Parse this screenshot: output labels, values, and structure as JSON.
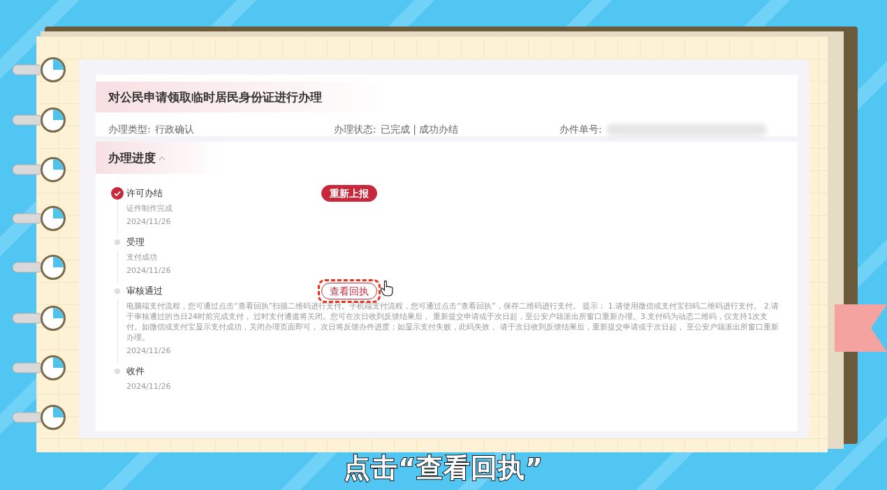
{
  "record": {
    "title": "对公民申请领取临时居民身份证进行办理",
    "fields": [
      {
        "label": "办理类型:",
        "value": "行政确认",
        "blurred": false
      },
      {
        "label": "办理状态:",
        "value": "已完成 | 成功办结",
        "blurred": false
      },
      {
        "label": "办件单号:",
        "blurred": true
      }
    ]
  },
  "progress": {
    "title": "办理进度",
    "expanded": true,
    "steps": [
      {
        "title": "许可办结",
        "done": true,
        "description": "证件制作完成",
        "date": "2024/11/26",
        "button": {
          "label": "重新上报",
          "kind": "filled",
          "highlighted": false
        }
      },
      {
        "title": "受理",
        "done": false,
        "description": "支付成功",
        "date": "2024/11/26"
      },
      {
        "title": "审核通过",
        "done": false,
        "description": "电脑端支付流程，您可通过点击“查看回执”扫描二维码进行支付。手机端支付流程，您可通过点击“查看回执”，保存二维码进行支付。 提示： 1.请使用微信或支付宝扫码二维码进行支付。 2.请于审核通过的当日24时前完成支付， 过时支付通道将关闭。您可在次日收到反馈结果后， 重新提交申请或于次日起，至公安户籍派出所窗口重新办理。3.支付码为动态二维码，仅支持1次支付。如微信或支付宝显示支付成功，关闭办理页面即可， 次日将反馈办件进度；如显示支付失败，此码失效， 请于次日收到反馈结果后，重新提交申请或于次日起， 至公安户籍派出所窗口重新办理。",
        "date": "2024/11/26",
        "button": {
          "label": "查看回执",
          "kind": "outline",
          "highlighted": true
        }
      },
      {
        "title": "收件",
        "done": false,
        "date": "2024/11/26"
      }
    ]
  },
  "caption": "点击“查看回执”"
}
